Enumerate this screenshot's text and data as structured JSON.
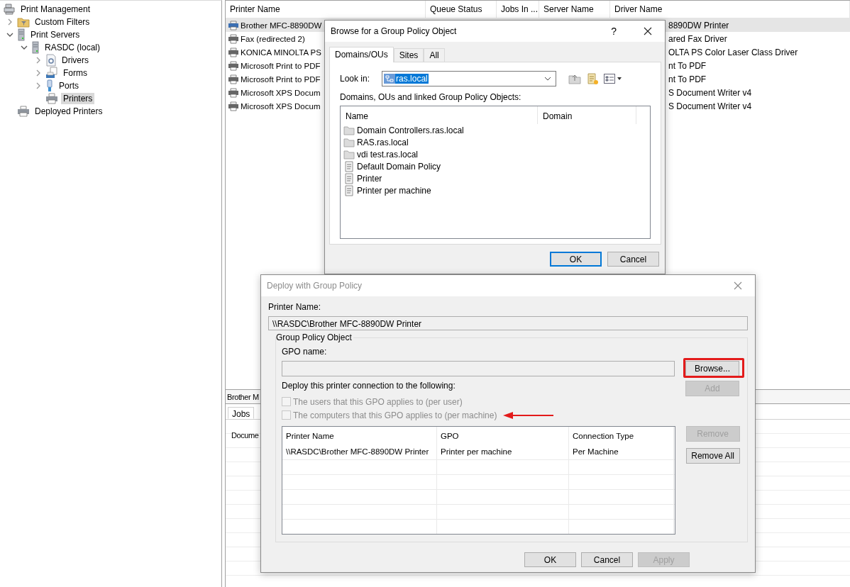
{
  "tree": [
    {
      "label": "Print Management",
      "kind": "root",
      "selected": false,
      "children": [
        {
          "label": "Custom Filters",
          "kind": "filter",
          "expanded": false,
          "selected": false
        },
        {
          "label": "Print Servers",
          "kind": "server",
          "expanded": true,
          "selected": false,
          "children": [
            {
              "label": "RASDC (local)",
              "kind": "server",
              "expanded": true,
              "selected": false,
              "children": [
                {
                  "label": "Drivers",
                  "kind": "drivers",
                  "expanded": false,
                  "selected": false
                },
                {
                  "label": "Forms",
                  "kind": "forms",
                  "expanded": false,
                  "selected": false
                },
                {
                  "label": "Ports",
                  "kind": "ports",
                  "expanded": false,
                  "selected": false
                },
                {
                  "label": "Printers",
                  "kind": "printer",
                  "selected": true
                }
              ]
            }
          ]
        },
        {
          "label": "Deployed Printers",
          "kind": "printer",
          "selected": false
        }
      ]
    }
  ],
  "printers": {
    "columns": [
      "Printer Name",
      "Queue Status",
      "Jobs In ...",
      "Server Name",
      "Driver Name"
    ],
    "rows": [
      {
        "name": "Brother MFC-8890DW",
        "driver": "8890DW Printer",
        "selected": true
      },
      {
        "name": "Fax (redirected 2)",
        "driver": "ared Fax Driver",
        "selected": false
      },
      {
        "name": "KONICA MINOLTA PS",
        "driver": "OLTA PS Color Laser Class Driver",
        "selected": false
      },
      {
        "name": "Microsoft Print to PDF",
        "driver": "nt To PDF",
        "selected": false
      },
      {
        "name": "Microsoft Print to PDF",
        "driver": "nt To PDF",
        "selected": false
      },
      {
        "name": "Microsoft XPS Docum",
        "driver": "S Document Writer v4",
        "selected": false
      },
      {
        "name": "Microsoft XPS Docum",
        "driver": "S Document Writer v4",
        "selected": false
      }
    ]
  },
  "details": {
    "title": "Brother M",
    "tabs": [
      {
        "label": "Jobs",
        "selected": true
      }
    ],
    "columns": [
      "Docume"
    ]
  },
  "browse_dialog": {
    "title": "Browse for a Group Policy Object",
    "help": "?",
    "tabs": [
      {
        "label": "Domains/OUs",
        "selected": true
      },
      {
        "label": "Sites",
        "selected": false
      },
      {
        "label": "All",
        "selected": false
      }
    ],
    "look_in_label": "Look in:",
    "look_in_value": "ras.local",
    "list_label": "Domains, OUs and linked Group Policy Objects:",
    "columns": [
      "Name",
      "Domain"
    ],
    "items": [
      {
        "name": "Domain Controllers.ras.local",
        "kind": "folder"
      },
      {
        "name": "RAS.ras.local",
        "kind": "folder"
      },
      {
        "name": "vdi test.ras.local",
        "kind": "folder"
      },
      {
        "name": "Default Domain Policy",
        "kind": "gpo"
      },
      {
        "name": "Printer",
        "kind": "gpo"
      },
      {
        "name": "Printer per machine",
        "kind": "gpo"
      }
    ],
    "buttons": [
      {
        "label": "OK",
        "default": true
      },
      {
        "label": "Cancel",
        "default": false
      }
    ]
  },
  "deploy_dialog": {
    "title": "Deploy with Group Policy",
    "printer_name_label": "Printer Name:",
    "printer_name_value": "\\\\RASDC\\Brother MFC-8890DW Printer",
    "group_title": "Group Policy Object",
    "gpo_name_label": "GPO name:",
    "browse_button": {
      "label": "Browse...",
      "disabled": false
    },
    "add_button": {
      "label": "Add",
      "disabled": true
    },
    "deploy_label": "Deploy this printer connection to the following:",
    "options": [
      {
        "label": "The users that this GPO applies to (per user)",
        "checked": false,
        "disabled": true
      },
      {
        "label": "The computers that this GPO applies to (per machine)",
        "checked": false,
        "disabled": true
      }
    ],
    "columns": [
      "Printer Name",
      "GPO",
      "Connection Type"
    ],
    "rows": [
      {
        "printer": "\\\\RASDC\\Brother MFC-8890DW Printer",
        "gpo": "Printer per machine",
        "type": "Per Machine"
      }
    ],
    "side_buttons": [
      {
        "label": "Remove",
        "disabled": true
      },
      {
        "label": "Remove All",
        "disabled": false
      }
    ],
    "buttons": [
      {
        "label": "OK",
        "disabled": false
      },
      {
        "label": "Cancel",
        "disabled": false
      },
      {
        "label": "Apply",
        "disabled": true
      }
    ]
  }
}
